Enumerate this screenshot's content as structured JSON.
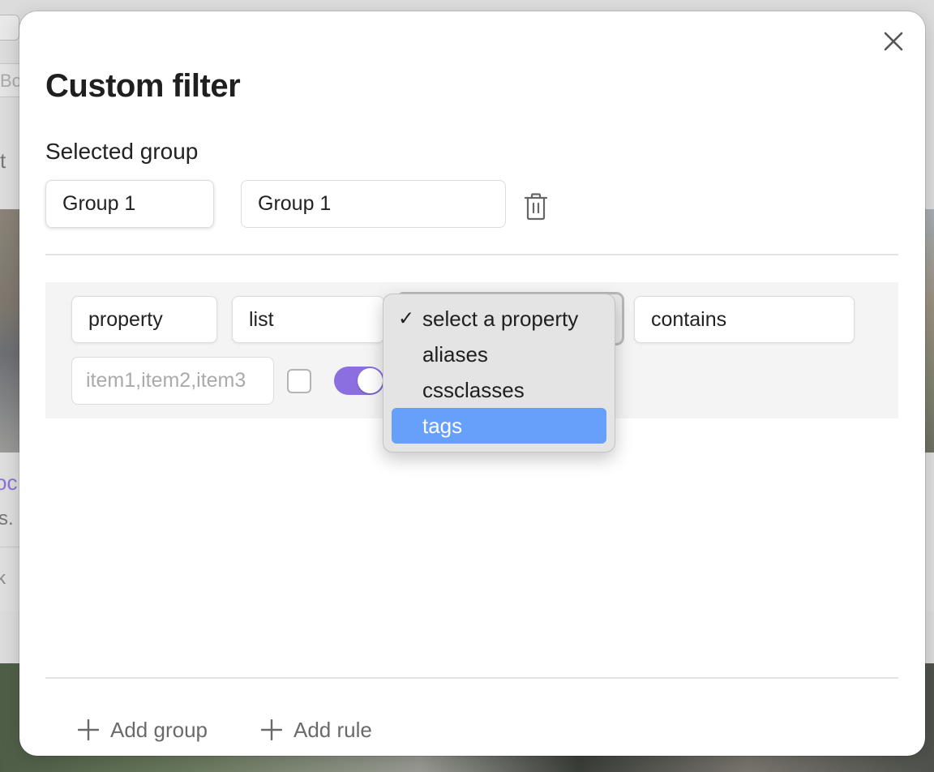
{
  "background": {
    "search_fragment": "Bo",
    "left_text_fragment": "t",
    "link_fragment": "oc",
    "text_fragment": "s.",
    "k_fragment": "k"
  },
  "modal": {
    "title": "Custom filter",
    "close_icon": "close-icon",
    "selected_group_label": "Selected group",
    "group_select_value": "Group 1",
    "group_name_value": "Group 1",
    "delete_icon": "trash-icon"
  },
  "rule": {
    "type_value": "property",
    "kind_value": "list",
    "property_value": "select a property",
    "operator_value": "contains",
    "value_placeholder": "item1,item2,item3",
    "value": "",
    "checkbox_checked": false,
    "toggle_on": true
  },
  "dropdown": {
    "options": [
      {
        "label": "select a property",
        "checked": true,
        "highlighted": false
      },
      {
        "label": "aliases",
        "checked": false,
        "highlighted": false
      },
      {
        "label": "cssclasses",
        "checked": false,
        "highlighted": false
      },
      {
        "label": "tags",
        "checked": false,
        "highlighted": true
      }
    ],
    "check_glyph": "✓"
  },
  "footer": {
    "add_group_label": "Add group",
    "add_rule_label": "Add rule"
  },
  "colors": {
    "accent": "#8b6ee0",
    "highlight": "#67a0fa"
  }
}
